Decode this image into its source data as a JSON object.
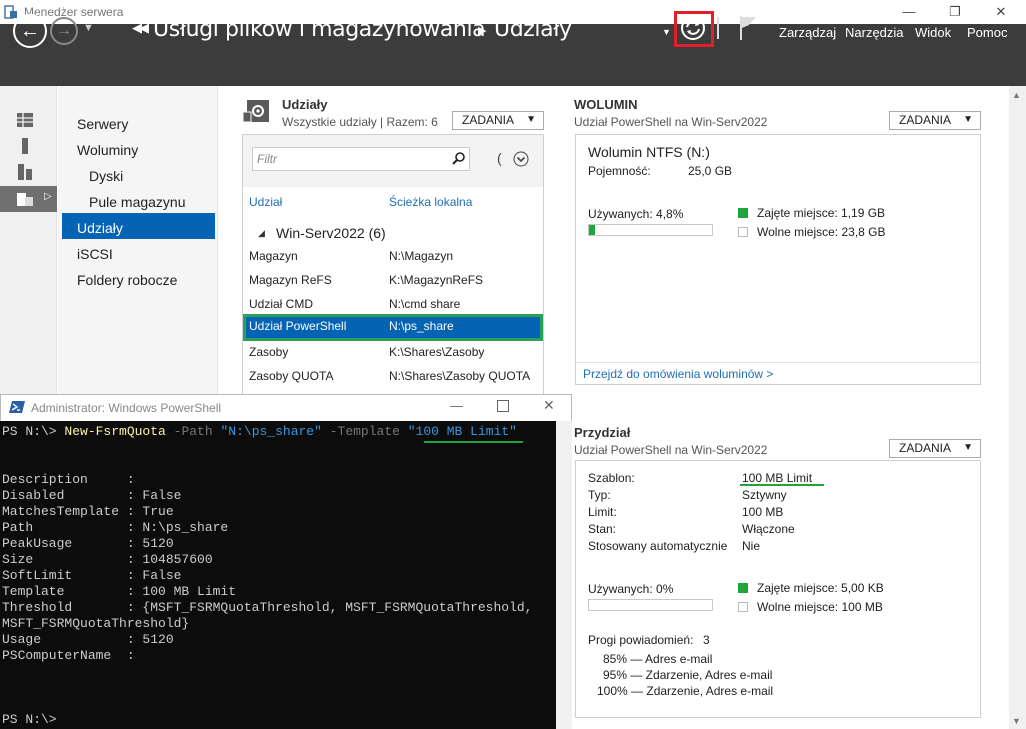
{
  "window": {
    "title": "Menedżer serwera",
    "controls": {
      "minimize": "—",
      "maximize": "❐",
      "close": "✕"
    }
  },
  "header": {
    "breadcrumb_root": "Usługi plików i magazynowania",
    "breadcrumb_leaf": "Udziały",
    "menu": [
      "Zarządzaj",
      "Narzędzia",
      "Widok",
      "Pomoc"
    ],
    "icons": [
      "back-icon",
      "forward-icon",
      "refresh-icon",
      "flag-icon"
    ],
    "refresh_highlight_color": "#e2202a"
  },
  "nav": {
    "items": [
      "Serwery",
      "Woluminy",
      "Dyski",
      "Pule magazynu",
      "Udziały",
      "iSCSI",
      "Foldery robocze"
    ],
    "selected": "Udziały",
    "accent": "#0463b3"
  },
  "shares": {
    "title": "Udziały",
    "subtitle": "Wszystkie udziały | Razem: 6",
    "tasks_label": "ZADANIA",
    "filter_placeholder": "Filtr",
    "columns": [
      "Udział",
      "Ścieżka lokalna"
    ],
    "group": "Win-Serv2022 (6)",
    "rows": [
      {
        "name": "Magazyn",
        "path": "N:\\Magazyn"
      },
      {
        "name": "Magazyn ReFS",
        "path": "K:\\MagazynReFS"
      },
      {
        "name": "Udział CMD",
        "path": "N:\\cmd share"
      },
      {
        "name": "Udział PowerShell",
        "path": "N:\\ps_share"
      },
      {
        "name": "Zasoby",
        "path": "K:\\Shares\\Zasoby"
      },
      {
        "name": "Zasoby QUOTA",
        "path": "N:\\Shares\\Zasoby QUOTA"
      }
    ],
    "selected_row": "Udział PowerShell",
    "selected_outline_color": "#2aa05a"
  },
  "volume": {
    "title": "WOLUMIN",
    "subtitle": "Udział PowerShell na Win-Serv2022",
    "tasks_label": "ZADANIA",
    "name": "Wolumin NTFS (N:)",
    "capacity_label": "Pojemność:",
    "capacity_value": "25,0 GB",
    "used_label": "Używanych: 4,8%",
    "used_fraction": 0.048,
    "used_space": "Zajęte miejsce: 1,19 GB",
    "free_space": "Wolne miejsce: 23,8 GB",
    "link": "Przejdź do omówienia woluminów >"
  },
  "quota": {
    "title": "Przydział",
    "subtitle": "Udział PowerShell na Win-Serv2022",
    "tasks_label": "ZADANIA",
    "fields": [
      {
        "k": "Szablon:",
        "v": "100 MB Limit"
      },
      {
        "k": "Typ:",
        "v": "Sztywny"
      },
      {
        "k": "Limit:",
        "v": "100 MB"
      },
      {
        "k": "Stan:",
        "v": "Włączone"
      },
      {
        "k": "Stosowany automatycznie",
        "v": "Nie"
      }
    ],
    "used_label": "Używanych: 0%",
    "used_fraction": 0.0,
    "used_space": "Zajęte miejsce: 5,00 KB",
    "free_space": "Wolne miejsce: 100 MB",
    "thresholds_label": "Progi powiadomień:",
    "thresholds_count": "3",
    "thresholds": [
      "85% — Adres e-mail",
      "95% — Zdarzenie, Adres e-mail",
      "100% — Zdarzenie, Adres e-mail"
    ]
  },
  "powershell": {
    "title": "Administrator: Windows PowerShell",
    "prompt": "PS N:\\>",
    "cmdlet": "New-FsrmQuota",
    "param_path": "-Path",
    "arg_path": "\"N:\\ps_share\"",
    "param_template": "-Template",
    "arg_template": "\"100 MB Limit\"",
    "output": [
      "Description     :",
      "Disabled        : False",
      "MatchesTemplate : True",
      "Path            : N:\\ps_share",
      "PeakUsage       : 5120",
      "Size            : 104857600",
      "SoftLimit       : False",
      "Template        : 100 MB Limit",
      "Threshold       : {MSFT_FSRMQuotaThreshold, MSFT_FSRMQuotaThreshold,",
      "MSFT_FSRMQuotaThreshold}",
      "Usage           : 5120",
      "PSComputerName  :"
    ],
    "final_prompt": "PS N:\\>",
    "highlight_color": "#1fa53b"
  }
}
